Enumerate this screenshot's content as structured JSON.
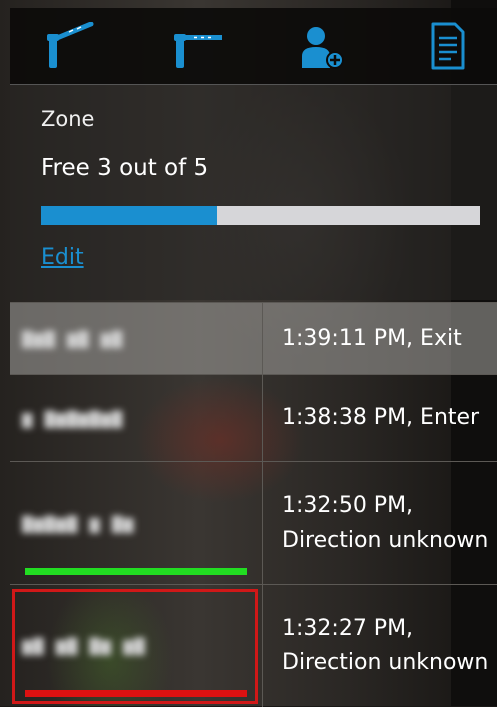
{
  "toolbar": {
    "buttons": [
      {
        "name": "barrier-open-icon"
      },
      {
        "name": "barrier-closed-icon"
      },
      {
        "name": "add-person-icon"
      },
      {
        "name": "document-icon"
      }
    ]
  },
  "zone": {
    "label": "Zone",
    "free_text": "Free 3 out of 5",
    "free": 3,
    "total": 5,
    "occupancy_fraction": 0.4,
    "edit_label": "Edit",
    "bar_fill_color": "#1a8fd0",
    "bar_bg_color": "#d6d6d9"
  },
  "events": [
    {
      "plate": "▇▆▇ ▆▇ ▆▇",
      "time": "1:39:11 PM, Exit",
      "selected": true
    },
    {
      "plate": "▆ ▇▆▇▆▇▆▇",
      "time": "1:38:38 PM, Enter",
      "selected": false
    },
    {
      "plate": "▇▆▇▆▇ ▆ ▇▆",
      "time": "1:32:50 PM, Direction unknown",
      "selected": false,
      "indicator_color": "#22dd22"
    },
    {
      "plate": "▆▇ ▆▇ ▇▆ ▆▇",
      "time": "1:32:27 PM, Direction unknown",
      "selected": false,
      "indicator_color": "#dd1111",
      "alert": true
    }
  ]
}
